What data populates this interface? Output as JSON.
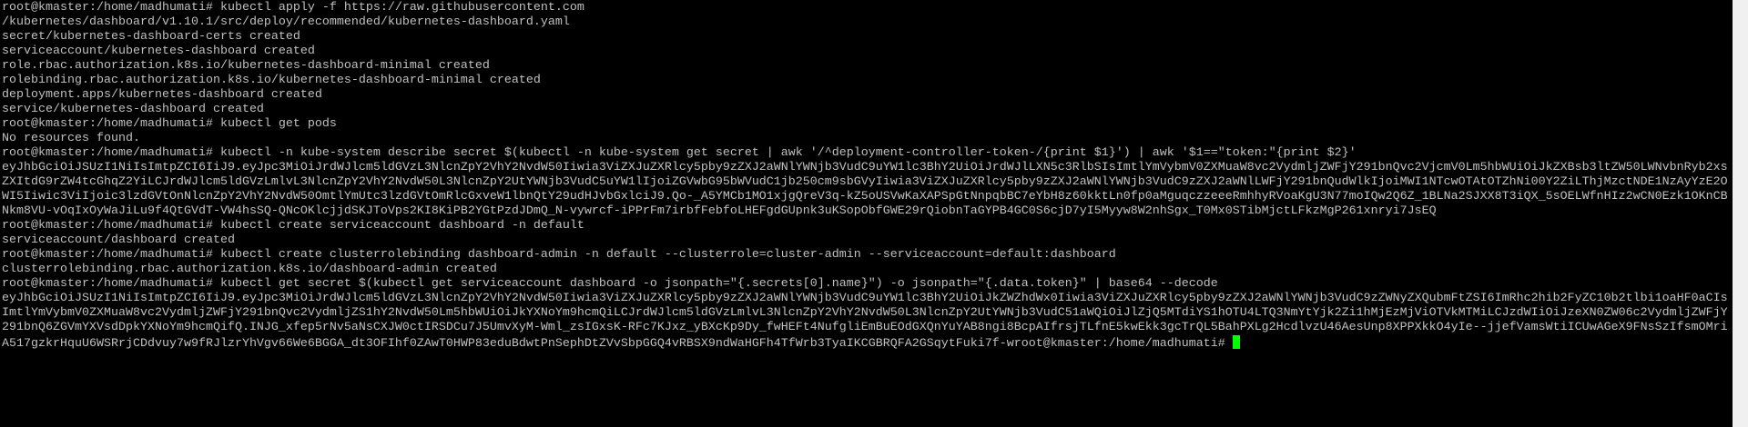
{
  "terminal": {
    "cursor_color": "#00ff00",
    "text_color": "#c0c0c0",
    "background": "#000000",
    "lines": [
      "root@kmaster:/home/madhumati# kubectl apply -f https://raw.githubusercontent.com",
      "/kubernetes/dashboard/v1.10.1/src/deploy/recommended/kubernetes-dashboard.yaml",
      "secret/kubernetes-dashboard-certs created",
      "serviceaccount/kubernetes-dashboard created",
      "role.rbac.authorization.k8s.io/kubernetes-dashboard-minimal created",
      "rolebinding.rbac.authorization.k8s.io/kubernetes-dashboard-minimal created",
      "deployment.apps/kubernetes-dashboard created",
      "service/kubernetes-dashboard created",
      "root@kmaster:/home/madhumati# kubectl get pods",
      "No resources found.",
      "root@kmaster:/home/madhumati# kubectl -n kube-system describe secret $(kubectl -n kube-system get secret | awk '/^deployment-controller-token-/{print $1}') | awk '$1==\"token:\"{print $2}'",
      "eyJhbGciOiJSUzI1NiIsImtpZCI6IiJ9.eyJpc3MiOiJrdWJlcm5ldGVzL3NlcnZpY2VhY2NvdW50Iiwia3ViZXJuZXRlcy5pby9zZXJ2aWNlYWNjb3VudC9uYW1lc3BhY2UiOiJrdWJlLXN5c3RlbSIsImtlYmVybmV0ZXMuaW8vc2VydmljZWFjY291bnQvc2VjcmV0Lm5hbWUiOiJkZXBsb3ltZW50LWNvbnRyb2xs",
      "ZXItdG9rZW4tcGhqZ2YiLCJrdWJlcm5ldGVzLmlvL3NlcnZpY2VhY2NvdW50L3NlcnZpY2UtYWNjb3VudC5uYW1lIjoiZGVwbG95bWVudC1jb250cm9sbGVyIiwia3ViZXJuZXRlcy5pby9zZXJ2aWNlYWNjb3VudC9zZXJ2aWNlLWFjY291bnQudWlkIjoiMWI1NTcwOTAtOTZhNi00Y2ZiLThjMzctNDE1NzAyYzE2O",
      "WI5Iiwic3ViIjoic3lzdGVtOnNlcnZpY2VhY2NvdW50OmtlYmUtc3lzdGVtOmRlcGxveW1lbnQtY29udHJvbGxlciJ9.Qo-_A5YMCb1MO1xjgQreV3q-kZ5oUSVwKaXAPSpGtNnpqbBC7eYbH8z60kktLn0fp0aMguqczzeeeRmhhyRVoaKgU3N77moIQw2Q6Z_1BLNa2SJXX8T3iQX_5sOELWfnHIz2wCN0Ezk1OKnCB",
      "Nkm8VU-vOqIxOyWaJiLu9f4QtGVdT-VW4hsSQ-QNcOKlcjjdSKJToVps2KI8KiPB2YGtPzdJDmQ_N-vywrcf-iPPrFm7irbfFebfoLHEFgdGUpnk3uKSopObfGWE29rQiobnTaGYPB4GC0S6cjD7yI5Myyw8W2nhSgx_T0Mx0STibMjctLFkzMgP261xnryi7JsEQ",
      "root@kmaster:/home/madhumati# kubectl create serviceaccount dashboard -n default",
      "serviceaccount/dashboard created",
      "root@kmaster:/home/madhumati# kubectl create clusterrolebinding dashboard-admin -n default --clusterrole=cluster-admin --serviceaccount=default:dashboard",
      "clusterrolebinding.rbac.authorization.k8s.io/dashboard-admin created",
      "root@kmaster:/home/madhumati# kubectl get secret $(kubectl get serviceaccount dashboard -o jsonpath=\"{.secrets[0].name}\") -o jsonpath=\"{.data.token}\" | base64 --decode",
      "eyJhbGciOiJSUzI1NiIsImtpZCI6IiJ9.eyJpc3MiOiJrdWJlcm5ldGVzL3NlcnZpY2VhY2NvdW50Iiwia3ViZXJuZXRlcy5pby9zZXJ2aWNlYWNjb3VudC9uYW1lc3BhY2UiOiJkZWZhdWx0Iiwia3ViZXJuZXRlcy5pby9zZXJ2aWNlYWNjb3VudC9zZWNyZXQubmFtZSI6ImRhc2hib2FyZC10b2tlbi1oaHF0aCIs",
      "ImtlYmVybmV0ZXMuaW8vc2VydmljZWFjY291bnQvc2VydmljZS1hY2NvdW50Lm5hbWUiOiJkYXNoYm9hcmQiLCJrdWJlcm5ldGVzLmlvL3NlcnZpY2VhY2NvdW50L3NlcnZpY2UtYWNjb3VudC51aWQiOiJlZjQ5MTdiYS1hOTU4LTQ3NmYtYjk2Zi1hMjEzMjViOTVkMTMiLCJzdWIiOiJzeXN0ZW06c2VydmljZWFjY",
      "291bnQ6ZGVmYXVsdDpkYXNoYm9hcmQifQ.INJG_xfep5rNv5aNsCXJW0ctIRSDCu7J5UmvXyM-Wml_zsIGxsK-RFc7KJxz_yBXcKp9Dy_fwHEFt4NufgliEmBuEOdGXQnYuYAB8ngi8BcpAIfrsjTLfnE5kwEkk3gcTrQL5BahPXLg2HcdlvzU46AesUnp8XPPXkkO4yIe--jjefVamsWtiICUwAGeX9FNsSzIfsmOMri"
    ],
    "last_line": "A517gzkrHquU6WSRrjCDdvuy7w9fRJlzrYhVgv66We6BGGA_dt3OFIhf0ZAwT0HWP83eduBdwtPnSephDtZVvSbpGGQ4vRBSX9ndWaHGFh4TfWrb3TyaIKCGBRQFA2GSqytFuki7f-w",
    "prompt": "root@kmaster:/home/madhumati# "
  }
}
